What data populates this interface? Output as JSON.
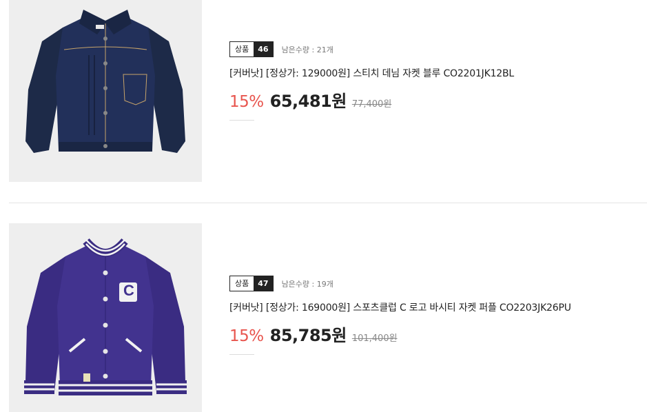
{
  "products": [
    {
      "badge_label": "상품",
      "badge_number": "46",
      "stock": "남은수량 : 21개",
      "title": "[커버낫] [정상가: 129000원] 스티치 데님 자켓 블루 CO2201JK12BL",
      "discount": "15%",
      "sale_price": "65,481원",
      "original_price": "77,400원",
      "image_icon": "denim-jacket"
    },
    {
      "badge_label": "상품",
      "badge_number": "47",
      "stock": "남은수량 : 19개",
      "title": "[커버낫] [정상가: 169000원] 스포츠클럽 C 로고 바시티 자켓 퍼플 CO2203JK26PU",
      "discount": "15%",
      "sale_price": "85,785원",
      "original_price": "101,400원",
      "image_icon": "varsity-jacket",
      "logo_letter": "C"
    }
  ],
  "colors": {
    "discount": "#e8554e",
    "denim": "#1f2d4d",
    "varsity": "#3e2f8a"
  }
}
